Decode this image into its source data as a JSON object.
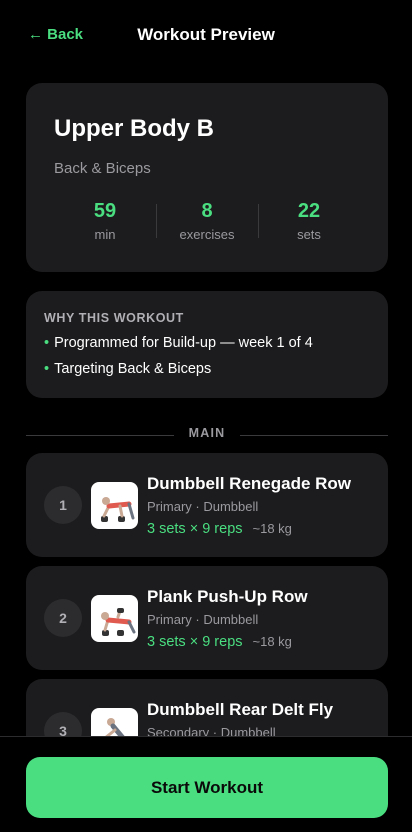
{
  "header": {
    "back_label": "← Back",
    "title": "Workout Preview"
  },
  "workout": {
    "title": "Upper Body B",
    "subtitle": "Back & Biceps",
    "stats": [
      {
        "value": "59",
        "label": "min"
      },
      {
        "value": "8",
        "label": "exercises"
      },
      {
        "value": "22",
        "label": "sets"
      }
    ]
  },
  "why": {
    "title": "WHY THIS WORKOUT",
    "items": [
      "Programmed for Build-up — week 1 of 4",
      "Targeting Back & Biceps"
    ],
    "bullet": "•"
  },
  "section": {
    "label": "MAIN"
  },
  "exercises": [
    {
      "number": "1",
      "name": "Dumbbell Renegade Row",
      "meta": "Primary · Dumbbell",
      "sets": "3 sets × 9 reps",
      "weight": "~18 kg",
      "thumbnail_icon": "renegade-row-illustration"
    },
    {
      "number": "2",
      "name": "Plank Push-Up Row",
      "meta": "Primary · Dumbbell",
      "sets": "3 sets × 9 reps",
      "weight": "~18 kg",
      "thumbnail_icon": "plank-push-up-row-illustration"
    },
    {
      "number": "3",
      "name": "Dumbbell Rear Delt Fly",
      "meta": "Secondary · Dumbbell",
      "sets": "",
      "weight": "",
      "thumbnail_icon": "rear-delt-fly-illustration"
    }
  ],
  "cta": {
    "start_label": "Start Workout"
  },
  "colors": {
    "accent": "#4ade80",
    "background": "#000000",
    "card": "#1c1c1e"
  }
}
